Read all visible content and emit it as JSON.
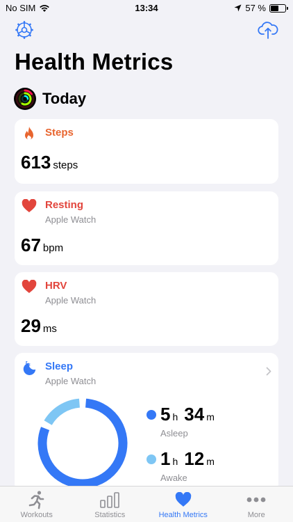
{
  "status_bar": {
    "carrier": "No SIM",
    "time": "13:34",
    "battery_text": "57 %",
    "battery_level": 0.57
  },
  "header": {
    "settings_icon": "gear-icon",
    "upload_icon": "cloud-upload-icon"
  },
  "title": "Health Metrics",
  "today": {
    "label": "Today",
    "icon": "activity-rings-icon"
  },
  "cards": {
    "steps": {
      "title": "Steps",
      "value": "613",
      "unit": "steps",
      "icon": "flame-icon",
      "color": "#e8652f"
    },
    "resting": {
      "title": "Resting",
      "source": "Apple Watch",
      "value": "67",
      "unit": "bpm",
      "icon": "heart-icon",
      "color": "#e2453c"
    },
    "hrv": {
      "title": "HRV",
      "source": "Apple Watch",
      "value": "29",
      "unit": "ms",
      "icon": "heart-icon",
      "color": "#e2453c"
    },
    "sleep": {
      "title": "Sleep",
      "source": "Apple Watch",
      "icon": "sleep-moon-icon",
      "color": "#3478f6",
      "asleep": {
        "hours": "5",
        "h_unit": "h",
        "minutes": "34",
        "m_unit": "m",
        "label": "Asleep",
        "color": "#3478f6"
      },
      "awake": {
        "hours": "1",
        "h_unit": "h",
        "minutes": "12",
        "m_unit": "m",
        "label": "Awake",
        "color": "#7ec6f4"
      }
    }
  },
  "chart_data": {
    "type": "pie",
    "categories": [
      "Asleep",
      "Awake"
    ],
    "values": [
      334,
      72
    ],
    "colors": [
      "#3478f6",
      "#7ec6f4"
    ]
  },
  "tab_bar": {
    "items": [
      {
        "label": "Workouts",
        "icon": "running-figure-icon",
        "active": false
      },
      {
        "label": "Statistics",
        "icon": "bar-chart-icon",
        "active": false
      },
      {
        "label": "Health Metrics",
        "icon": "heart-icon",
        "active": true
      },
      {
        "label": "More",
        "icon": "ellipsis-icon",
        "active": false
      }
    ]
  }
}
